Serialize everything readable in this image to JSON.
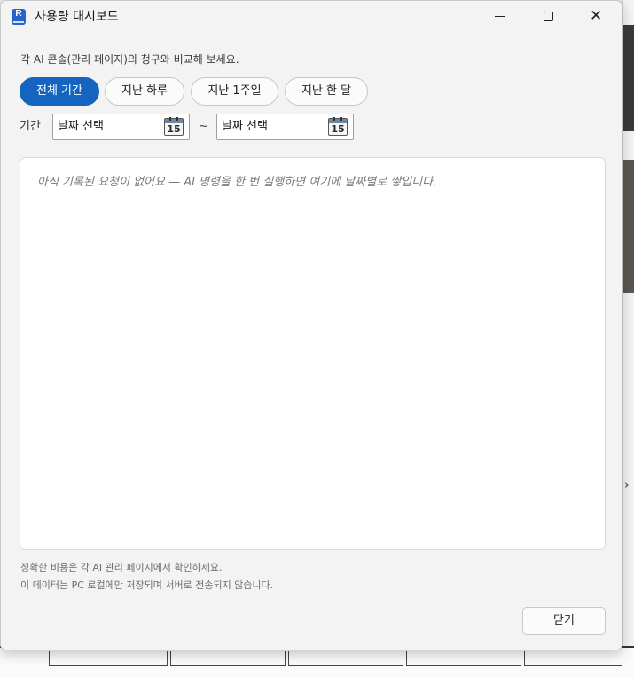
{
  "window": {
    "title": "사용량 대시보드",
    "app_icon_letter": "R"
  },
  "subtitle": "각 AI 콘솔(관리 페이지)의 청구와 비교해 보세요.",
  "range_buttons": [
    {
      "label": "전체 기간",
      "selected": true
    },
    {
      "label": "지난 하루",
      "selected": false
    },
    {
      "label": "지난 1주일",
      "selected": false
    },
    {
      "label": "지난 한 달",
      "selected": false
    }
  ],
  "period": {
    "label": "기간",
    "from_placeholder": "날짜 선택",
    "separator": "~",
    "to_placeholder": "날짜 선택",
    "calendar_day": "15"
  },
  "log_panel": {
    "empty_message": "아직 기록된 요청이 없어요 — AI 명령을 한 번 실행하면 여기에 날짜별로 쌓입니다."
  },
  "footer": {
    "note_cost": "정확한 비용은 각 AI 관리 페이지에서 확인하세요.",
    "note_privacy": "이 데이터는 PC 로컬에만 저장되며 서버로 전송되지 않습니다.",
    "close_label": "닫기"
  },
  "colors": {
    "accent": "#1564c0",
    "window_bg": "#f3f3f3",
    "panel_bg": "#ffffff",
    "muted_text": "#7a7a7a"
  }
}
